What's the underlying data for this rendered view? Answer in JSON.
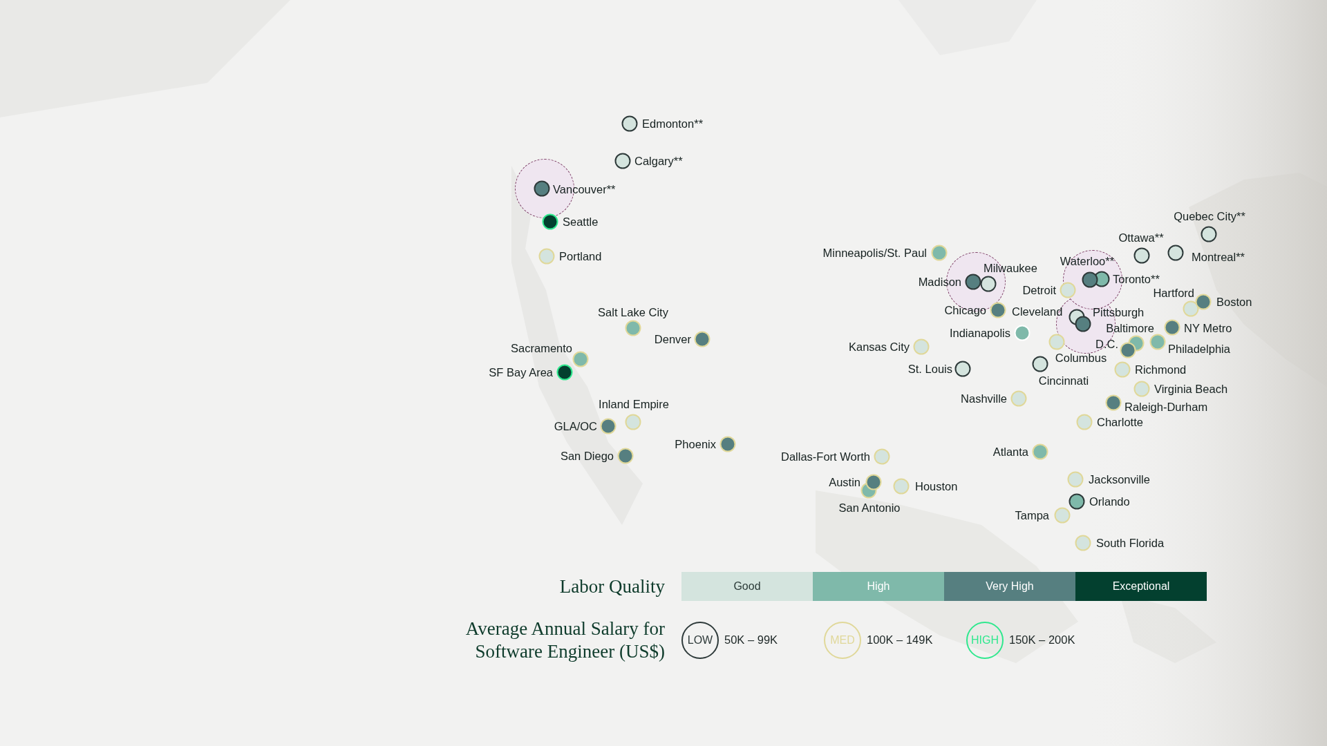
{
  "map": {
    "cities": [
      {
        "name": "Edmonton**",
        "color": "#d4e4de",
        "kind": "low",
        "highlighted": false
      },
      {
        "name": "Calgary**",
        "color": "#d4e4de",
        "kind": "low",
        "highlighted": false
      },
      {
        "name": "Vancouver**",
        "color": "#567f80",
        "kind": "low",
        "highlighted": true
      },
      {
        "name": "Seattle",
        "color": "#03402f",
        "kind": "high",
        "highlighted": false
      },
      {
        "name": "Portland",
        "color": "#d4e4de",
        "kind": "med",
        "highlighted": false
      },
      {
        "name": "Salt Lake City",
        "color": "#7fb9aa",
        "kind": "med",
        "highlighted": false
      },
      {
        "name": "Denver",
        "color": "#567f80",
        "kind": "med",
        "highlighted": false
      },
      {
        "name": "Sacramento",
        "color": "#7fb9aa",
        "kind": "med",
        "highlighted": false
      },
      {
        "name": "SF Bay Area",
        "color": "#03402f",
        "kind": "high",
        "highlighted": false
      },
      {
        "name": "Inland Empire",
        "color": "#d4e4de",
        "kind": "med",
        "highlighted": false
      },
      {
        "name": "GLA/OC",
        "color": "#567f80",
        "kind": "med",
        "highlighted": false
      },
      {
        "name": "San Diego",
        "color": "#567f80",
        "kind": "med",
        "highlighted": false
      },
      {
        "name": "Phoenix",
        "color": "#567f80",
        "kind": "med",
        "highlighted": false
      },
      {
        "name": "Minneapolis/St. Paul",
        "color": "#7fb9aa",
        "kind": "med",
        "highlighted": false
      },
      {
        "name": "Madison",
        "color": "#567f80",
        "kind": "low",
        "highlighted": true
      },
      {
        "name": "Milwaukee",
        "color": "#d4e4de",
        "kind": "low",
        "highlighted": false
      },
      {
        "name": "Detroit",
        "color": "#d4e4de",
        "kind": "med",
        "highlighted": false
      },
      {
        "name": "Chicago",
        "color": "#567f80",
        "kind": "med",
        "highlighted": false
      },
      {
        "name": "Cleveland",
        "color": "#d4e4de",
        "kind": "low",
        "highlighted": false
      },
      {
        "name": "Pittsburgh",
        "color": "#567f80",
        "kind": "low",
        "highlighted": true
      },
      {
        "name": "Indianapolis",
        "color": "#7fb9aa",
        "kind": "none",
        "highlighted": false
      },
      {
        "name": "Columbus",
        "color": "#d4e4de",
        "kind": "med",
        "highlighted": false
      },
      {
        "name": "Kansas City",
        "color": "#d4e4de",
        "kind": "med",
        "highlighted": false
      },
      {
        "name": "St. Louis",
        "color": "#d4e4de",
        "kind": "low",
        "highlighted": false
      },
      {
        "name": "Cincinnati",
        "color": "#d4e4de",
        "kind": "low",
        "highlighted": false
      },
      {
        "name": "Nashville",
        "color": "#d4e4de",
        "kind": "med",
        "highlighted": false
      },
      {
        "name": "Toronto**",
        "color": "#7fb9aa",
        "kind": "low",
        "highlighted": false
      },
      {
        "name": "Waterloo**",
        "color": "#567f80",
        "kind": "low",
        "highlighted": true
      },
      {
        "name": "Ottawa**",
        "color": "#d4e4de",
        "kind": "low",
        "highlighted": false
      },
      {
        "name": "Quebec City**",
        "color": "#d4e4de",
        "kind": "low",
        "highlighted": false
      },
      {
        "name": "Montreal**",
        "color": "#d4e4de",
        "kind": "low",
        "highlighted": false
      },
      {
        "name": "Hartford",
        "color": "#d4e4de",
        "kind": "med",
        "highlighted": false
      },
      {
        "name": "Boston",
        "color": "#567f80",
        "kind": "med",
        "highlighted": false
      },
      {
        "name": "Baltimore",
        "color": "#7fb9aa",
        "kind": "med",
        "highlighted": false
      },
      {
        "name": "NY Metro",
        "color": "#567f80",
        "kind": "med",
        "highlighted": false
      },
      {
        "name": "Philadelphia",
        "color": "#7fb9aa",
        "kind": "med",
        "highlighted": false
      },
      {
        "name": "D.C.",
        "color": "#567f80",
        "kind": "med",
        "highlighted": false
      },
      {
        "name": "Richmond",
        "color": "#d4e4de",
        "kind": "med",
        "highlighted": false
      },
      {
        "name": "Virginia Beach",
        "color": "#d4e4de",
        "kind": "med",
        "highlighted": false
      },
      {
        "name": "Raleigh-Durham",
        "color": "#567f80",
        "kind": "med",
        "highlighted": false
      },
      {
        "name": "Charlotte",
        "color": "#d4e4de",
        "kind": "med",
        "highlighted": false
      },
      {
        "name": "Atlanta",
        "color": "#7fb9aa",
        "kind": "med",
        "highlighted": false
      },
      {
        "name": "Dallas-Fort Worth",
        "color": "#d4e4de",
        "kind": "med",
        "highlighted": false
      },
      {
        "name": "San Antonio",
        "color": "#7fb9aa",
        "kind": "med",
        "highlighted": false
      },
      {
        "name": "Austin",
        "color": "#567f80",
        "kind": "med",
        "highlighted": false
      },
      {
        "name": "Houston",
        "color": "#d4e4de",
        "kind": "med",
        "highlighted": false
      },
      {
        "name": "Jacksonville",
        "color": "#d4e4de",
        "kind": "med",
        "highlighted": false
      },
      {
        "name": "Orlando",
        "color": "#7fb9aa",
        "kind": "low",
        "highlighted": false
      },
      {
        "name": "Tampa",
        "color": "#d4e4de",
        "kind": "med",
        "highlighted": false
      },
      {
        "name": "South Florida",
        "color": "#d4e4de",
        "kind": "med",
        "highlighted": false
      }
    ]
  },
  "legend": {
    "quality": {
      "title": "Labor Quality",
      "levels": [
        {
          "label": "Good",
          "color": "#d4e4de"
        },
        {
          "label": "High",
          "color": "#7fb9aa"
        },
        {
          "label": "Very High",
          "color": "#567f80"
        },
        {
          "label": "Exceptional",
          "color": "#03402f"
        }
      ]
    },
    "salary": {
      "title_lines": [
        "Average Annual Salary for",
        "Software Engineer (US$)"
      ],
      "levels": [
        {
          "badge": "LOW",
          "range": "50K – 99K",
          "kind": "low"
        },
        {
          "badge": "MED",
          "range": "100K – 149K",
          "kind": "med"
        },
        {
          "badge": "HIGH",
          "range": "150K – 200K",
          "kind": "high"
        }
      ]
    }
  }
}
